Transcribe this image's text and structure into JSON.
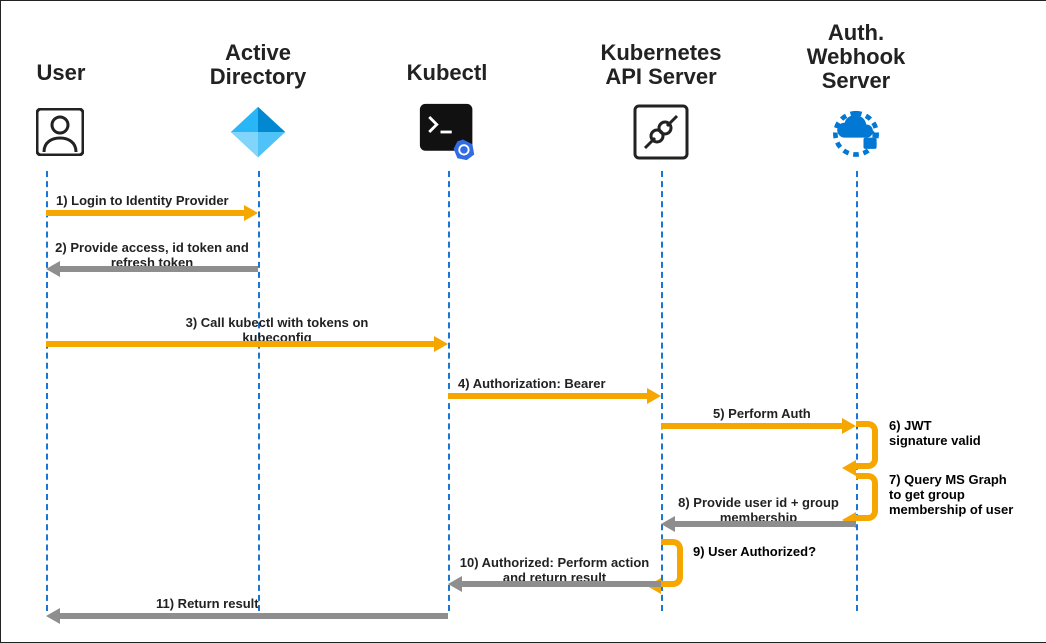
{
  "actors": {
    "user": "User",
    "ad": "Active\nDirectory",
    "kubectl": "Kubectl",
    "api": "Kubernetes\nAPI Server",
    "webhook": "Auth.\nWebhook\nServer"
  },
  "messages": {
    "m1": "1) Login to Identity Provider",
    "m2": "2) Provide access, id token and\nrefresh token",
    "m3": "3) Call kubectl with tokens on\nkubeconfig",
    "m4": "4) Authorization: Bearer",
    "m5": "5) Perform Auth",
    "m6": "6) JWT\nsignature valid",
    "m7": "7) Query MS Graph\nto get group\nmembership of user",
    "m8": "8) Provide user id + group\nmembership",
    "m9": "9) User Authorized?",
    "m10": "10) Authorized: Perform action\nand return result",
    "m11": "11) Return result"
  },
  "icons": {
    "user": "user-icon",
    "ad": "azure-ad-icon",
    "kubectl": "terminal-kubectl-icon",
    "api": "api-plug-icon",
    "webhook": "cloud-lock-icon"
  },
  "colors": {
    "orange": "#f5a700",
    "gray": "#8e8e8e",
    "blue": "#0078d4"
  }
}
